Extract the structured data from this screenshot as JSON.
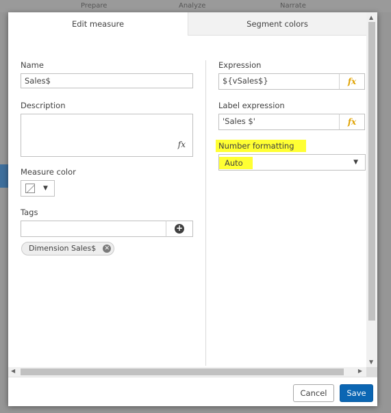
{
  "background": {
    "nav": [
      "Prepare",
      "Analyze",
      "Narrate"
    ]
  },
  "dialog": {
    "tabs": [
      {
        "label": "Edit measure",
        "active": true
      },
      {
        "label": "Segment colors",
        "active": false
      }
    ],
    "left": {
      "name_label": "Name",
      "name_value": "Sales$",
      "description_label": "Description",
      "description_value": "",
      "description_fx": "fx",
      "measure_color_label": "Measure color",
      "tags_label": "Tags",
      "tags_input_value": "",
      "tags": [
        "Dimension Sales$"
      ]
    },
    "right": {
      "expression_label": "Expression",
      "expression_value": "${vSales$}",
      "label_expression_label": "Label expression",
      "label_expression_value": "'Sales $'",
      "number_formatting_label": "Number formatting",
      "number_formatting_value": "Auto"
    },
    "fx_label": "fx",
    "footer": {
      "cancel_label": "Cancel",
      "save_label": "Save"
    }
  },
  "colors": {
    "highlight": "#ffff33",
    "save_button": "#0b66b3",
    "fx_icon": "#e0a200"
  }
}
